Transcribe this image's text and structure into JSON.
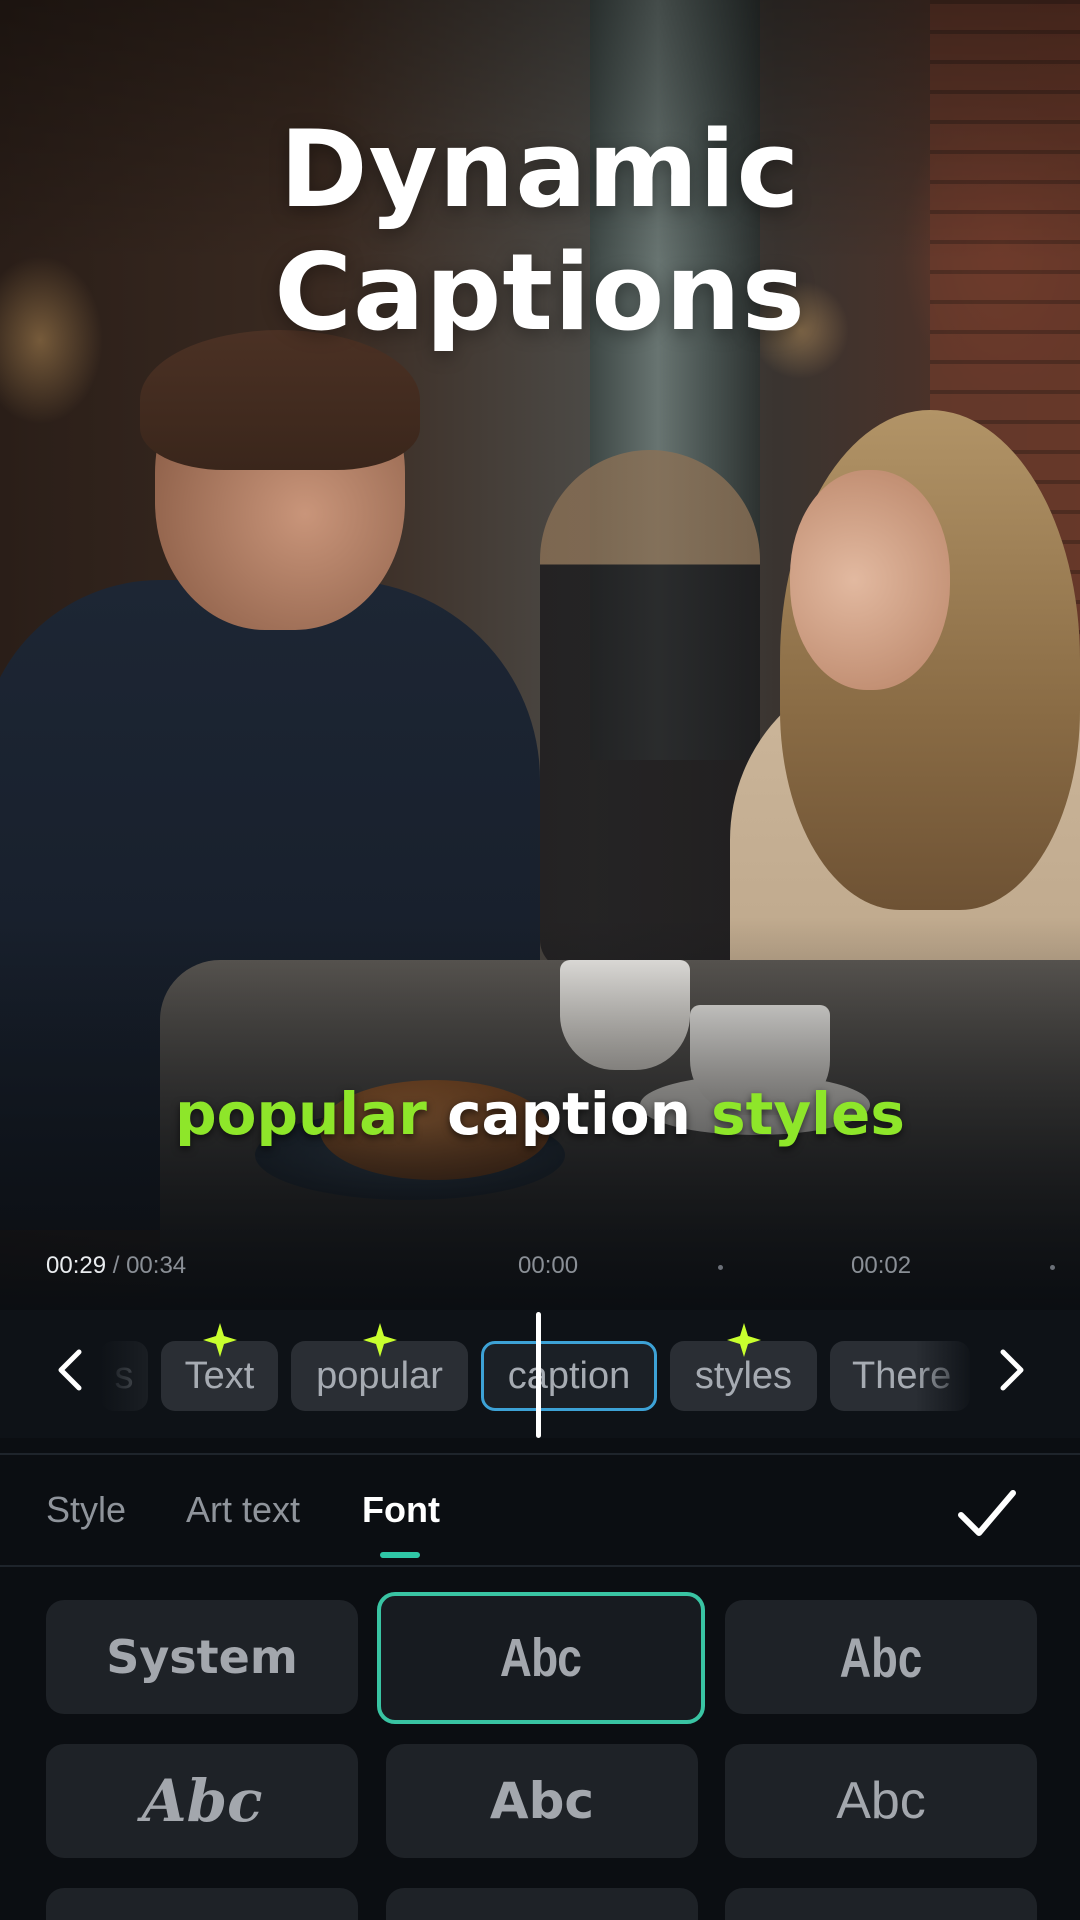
{
  "video": {
    "headline": "Dynamic Captions",
    "caption_words": [
      {
        "text": "popular",
        "color": "#8ee62a"
      },
      {
        "text": "caption",
        "color": "#ffffff"
      },
      {
        "text": "styles",
        "color": "#8ee62a"
      }
    ]
  },
  "timeline": {
    "current_time": "00:29",
    "separator": " / ",
    "total_time": "00:34",
    "ticks": [
      "00:00",
      "00:02"
    ]
  },
  "word_track": {
    "chips": [
      {
        "text": "s",
        "highlighted": false
      },
      {
        "text": "Text",
        "highlighted": true
      },
      {
        "text": "popular",
        "highlighted": true
      },
      {
        "text": "caption",
        "highlighted": false,
        "selected": true
      },
      {
        "text": "styles",
        "highlighted": true
      },
      {
        "text": "There",
        "highlighted": false
      }
    ],
    "prev_icon": "chevron-left-icon",
    "next_icon": "chevron-right-icon"
  },
  "tabs": {
    "items": [
      "Style",
      "Art text",
      "Font"
    ],
    "active": "Font",
    "confirm_icon": "checkmark-icon"
  },
  "fonts": {
    "tiles": [
      "System",
      "Abc",
      "Abc",
      "Abc",
      "Abc",
      "Abc"
    ],
    "selected_index": 1
  },
  "colors": {
    "accent_teal": "#39c4a3",
    "caption_green": "#8ee62a",
    "selection_blue": "#3da2d6",
    "sparkle": "#c8ff2e"
  }
}
